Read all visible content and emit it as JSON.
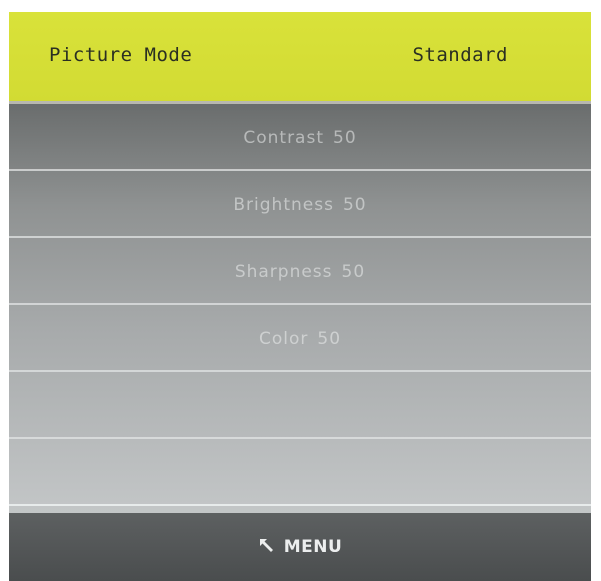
{
  "header": {
    "label": "Picture Mode",
    "value": "Standard"
  },
  "items": [
    {
      "label": "Contrast",
      "value": "50"
    },
    {
      "label": "Brightness",
      "value": "50"
    },
    {
      "label": "Sharpness",
      "value": "50"
    },
    {
      "label": "Color",
      "value": "50"
    },
    {
      "label": "",
      "value": ""
    },
    {
      "label": "",
      "value": ""
    }
  ],
  "footer": {
    "icon": "return-arrow-icon",
    "label": "MENU"
  }
}
